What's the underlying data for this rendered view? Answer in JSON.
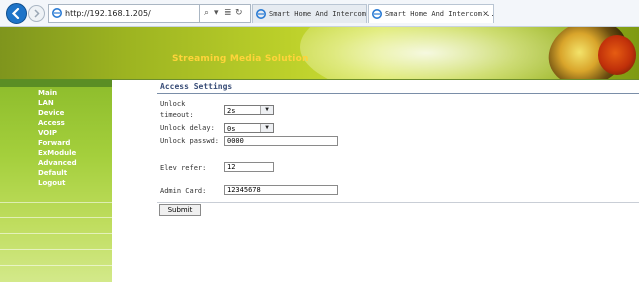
{
  "browser": {
    "address_url": "http://192.168.1.205/",
    "address_tools": {
      "search": "⌕",
      "sep": "▾",
      "compat": "≣",
      "refresh": "↻"
    },
    "tabs": [
      {
        "label": "Smart Home And Intercom Sys...",
        "active": false
      },
      {
        "label": "Smart Home And Intercom ...",
        "active": true,
        "close": "×"
      }
    ]
  },
  "banner": {
    "title": "Streaming Media Solution"
  },
  "sidebar": {
    "items": [
      {
        "label": "Main"
      },
      {
        "label": "LAN"
      },
      {
        "label": "Device"
      },
      {
        "label": "Access"
      },
      {
        "label": "VOIP"
      },
      {
        "label": "Forward"
      },
      {
        "label": "ExModule"
      },
      {
        "label": "Advanced"
      },
      {
        "label": "Default"
      },
      {
        "label": "Logout"
      }
    ]
  },
  "content": {
    "title": "Access Settings",
    "unlock_timeout": {
      "label_line1": "Unlock",
      "label_line2": "timeout:",
      "value": "2s"
    },
    "unlock_delay": {
      "label": "Unlock delay:",
      "value": "0s"
    },
    "unlock_passwd": {
      "label": "Unlock passwd:",
      "value": "0000"
    },
    "elev_refer": {
      "label": "Elev refer:",
      "value": "12"
    },
    "admin_card": {
      "label": "Admin Card:",
      "value": "12345678"
    },
    "submit_label": "Submit"
  },
  "colors": {
    "sidebar": "#9cc937",
    "banner_title": "#ffd43a",
    "section_title": "#3a4e78"
  }
}
